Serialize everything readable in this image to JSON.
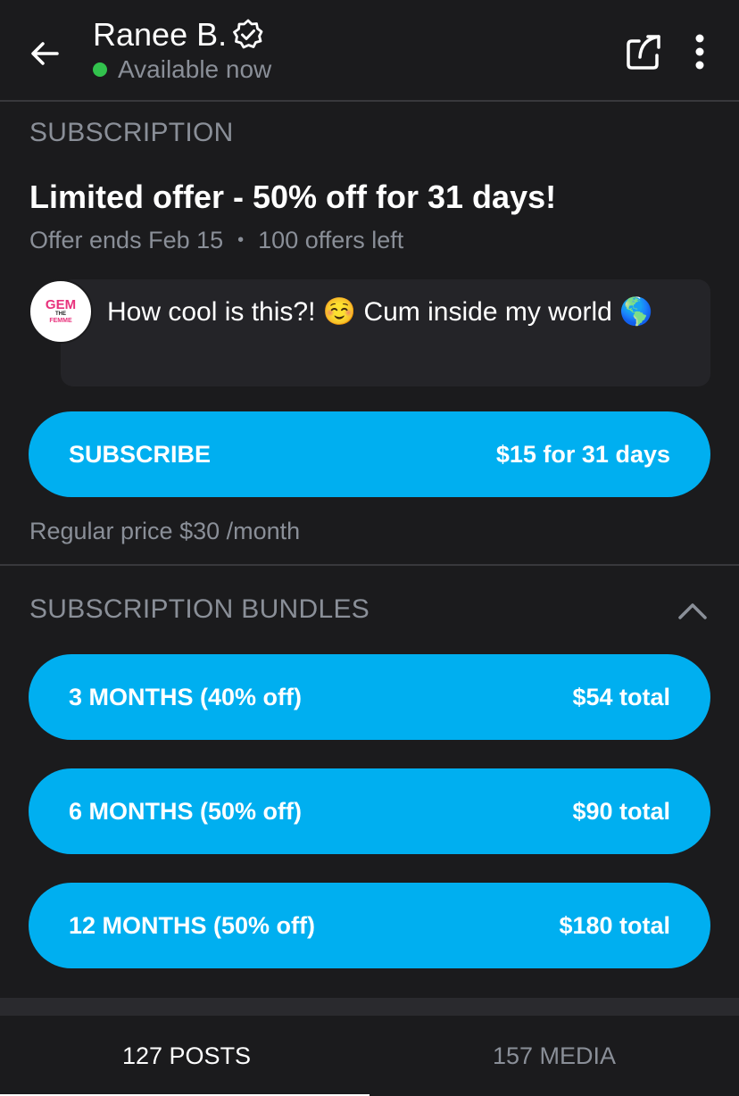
{
  "header": {
    "name": "Ranee B.",
    "status": "Available now",
    "status_color": "#32c24d"
  },
  "subscription": {
    "section_title": "SUBSCRIPTION",
    "offer_title": "Limited offer - 50% off for 31 days!",
    "offer_ends": "Offer ends Feb 15",
    "offers_left": "100 offers left",
    "message": "How cool is this?! ☺️ Cum inside my world 🌎",
    "avatar_logo": [
      "GEM",
      "THE",
      "FEMME"
    ],
    "subscribe_label": "SUBSCRIBE",
    "subscribe_price": "$15 for 31 days",
    "regular_price": "Regular price $30 /month"
  },
  "bundles": {
    "section_title": "SUBSCRIPTION BUNDLES",
    "items": [
      {
        "label": "3 MONTHS (40% off)",
        "price": "$54 total"
      },
      {
        "label": "6 MONTHS (50% off)",
        "price": "$90 total"
      },
      {
        "label": "12 MONTHS (50% off)",
        "price": "$180 total"
      }
    ]
  },
  "tabs": {
    "posts": "127 POSTS",
    "media": "157 MEDIA",
    "active": "posts"
  },
  "colors": {
    "accent": "#00aff0",
    "background": "#1b1b1d",
    "muted_text": "#8a8f98"
  },
  "icons": [
    "back-arrow-icon",
    "verified-badge-icon",
    "share-icon",
    "more-vertical-icon",
    "chevron-up-icon"
  ]
}
